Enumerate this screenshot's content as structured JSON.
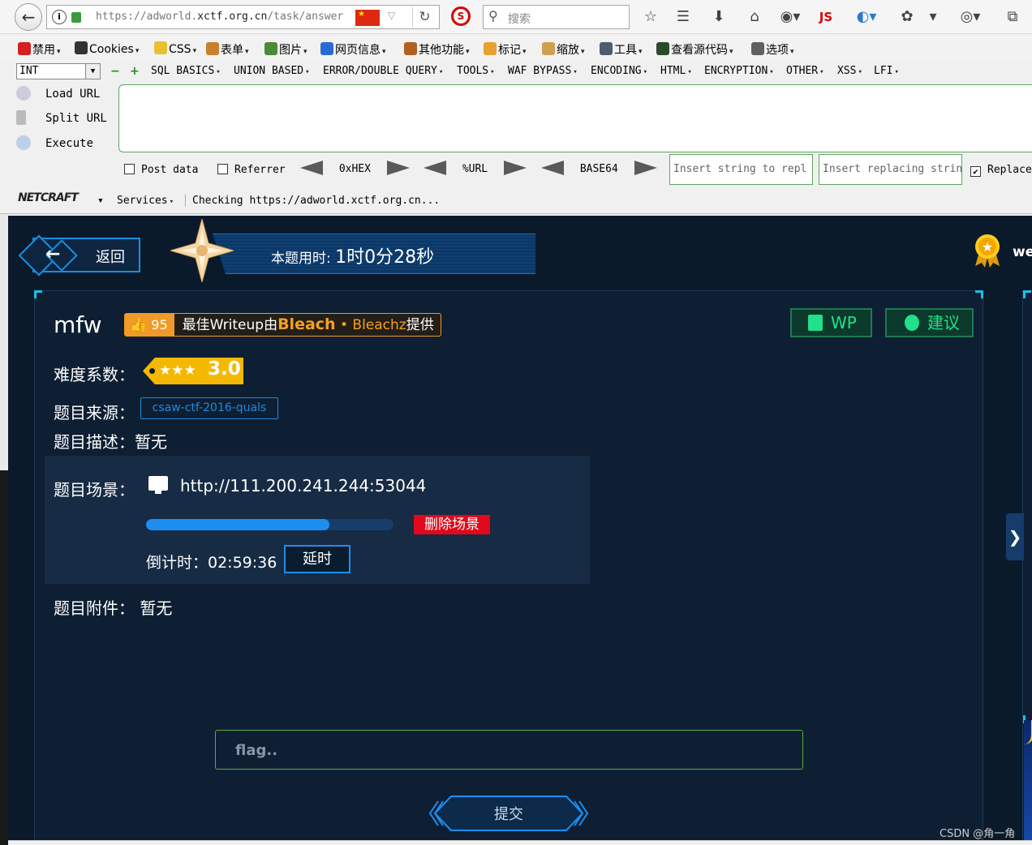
{
  "browser": {
    "url_prefix": "https://adworld.",
    "url_domain": "xctf.org.cn",
    "url_path": "/task/answer",
    "search_placeholder": "搜索",
    "js_label": "JS"
  },
  "menubar": [
    {
      "label": "禁用",
      "icon": "disable-icon",
      "color": "#d42020"
    },
    {
      "label": "Cookies",
      "icon": "cookie-icon",
      "color": "#333333"
    },
    {
      "label": "CSS",
      "icon": "css-icon",
      "color": "#e8c030"
    },
    {
      "label": "表单",
      "icon": "form-icon",
      "color": "#c8802a"
    },
    {
      "label": "图片",
      "icon": "image-icon",
      "color": "#4a8a3a"
    },
    {
      "label": "网页信息",
      "icon": "info-icon",
      "color": "#2a6ad4"
    },
    {
      "label": "其他功能",
      "icon": "misc-icon",
      "color": "#b06020"
    },
    {
      "label": "标记",
      "icon": "pencil-icon",
      "color": "#e8a030"
    },
    {
      "label": "缩放",
      "icon": "zoom-icon",
      "color": "#d0a050"
    },
    {
      "label": "工具",
      "icon": "tools-icon",
      "color": "#505a70"
    },
    {
      "label": "查看源代码",
      "icon": "source-icon",
      "color": "#2a4a2a"
    },
    {
      "label": "选项",
      "icon": "options-icon",
      "color": "#606060"
    }
  ],
  "hackbar": {
    "select_value": "INT",
    "menus": [
      "SQL BASICS",
      "UNION BASED",
      "ERROR/DOUBLE QUERY",
      "TOOLS",
      "WAF BYPASS",
      "ENCODING",
      "HTML",
      "ENCRYPTION",
      "OTHER",
      "XSS",
      "LFI"
    ],
    "load_url": "Load URL",
    "split_url": "Split URL",
    "execute": "Execute",
    "post_data": "Post data",
    "referrer": "Referrer",
    "hex": "0xHEX",
    "url": "%URL",
    "base64": "BASE64",
    "insert_placeholder": "Insert string to repl",
    "replacing_placeholder": "Insert replacing strin",
    "replace_all": "Replace All",
    "netcraft": "NETCRAFT",
    "services": "Services",
    "checking": "Checking https://adworld.xctf.org.cn..."
  },
  "page": {
    "back_label": "返回",
    "timer_label": "本题用时:",
    "timer_value": "1时0分28秒",
    "user_partial": "we",
    "title": "mfw",
    "like_count": "95",
    "writeup_prefix": "最佳Writeup由",
    "writeup_author": "Bleach",
    "writeup_sep": " • ",
    "writeup_author2": "Bleachz",
    "writeup_suffix": "提供",
    "wp_button": "WP",
    "suggest_button": "建议",
    "difficulty_label": "难度系数：",
    "difficulty_stars": "★★★",
    "difficulty_value": "3.0",
    "source_label": "题目来源：",
    "source_value": "csaw-ctf-2016-quals",
    "desc_label": "题目描述：暂无",
    "scene_label": "题目场景：",
    "scene_url": "http://111.200.241.244:53044",
    "progress": 0.74,
    "delete_scene": "删除场景",
    "countdown": "倒计时：02:59:36",
    "extend": "延时",
    "attachment_label": "题目附件：",
    "attachment_value": "暂无",
    "flag_placeholder": "flag..",
    "submit": "提交",
    "watermark": "CSDN @角一角"
  },
  "colors": {
    "page_bg": "#0b1a2b",
    "accent_blue": "#1c8ef0",
    "accent_green": "#21e08a",
    "accent_orange": "#f09a27",
    "danger": "#e0081a",
    "difficulty": "#f5b800"
  }
}
